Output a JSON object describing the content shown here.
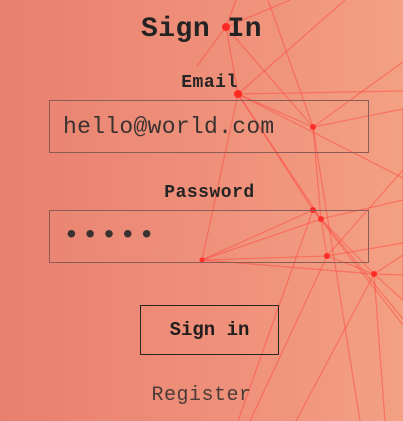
{
  "page": {
    "title": "Sign In"
  },
  "form": {
    "email_label": "Email",
    "email_value": "hello@world.com",
    "password_label": "Password",
    "password_value": "•••••",
    "signin_label": "Sign in",
    "register_label": "Register"
  },
  "colors": {
    "background_start": "#e8806e",
    "background_end": "#f3a083",
    "network": "#ff3b35"
  }
}
